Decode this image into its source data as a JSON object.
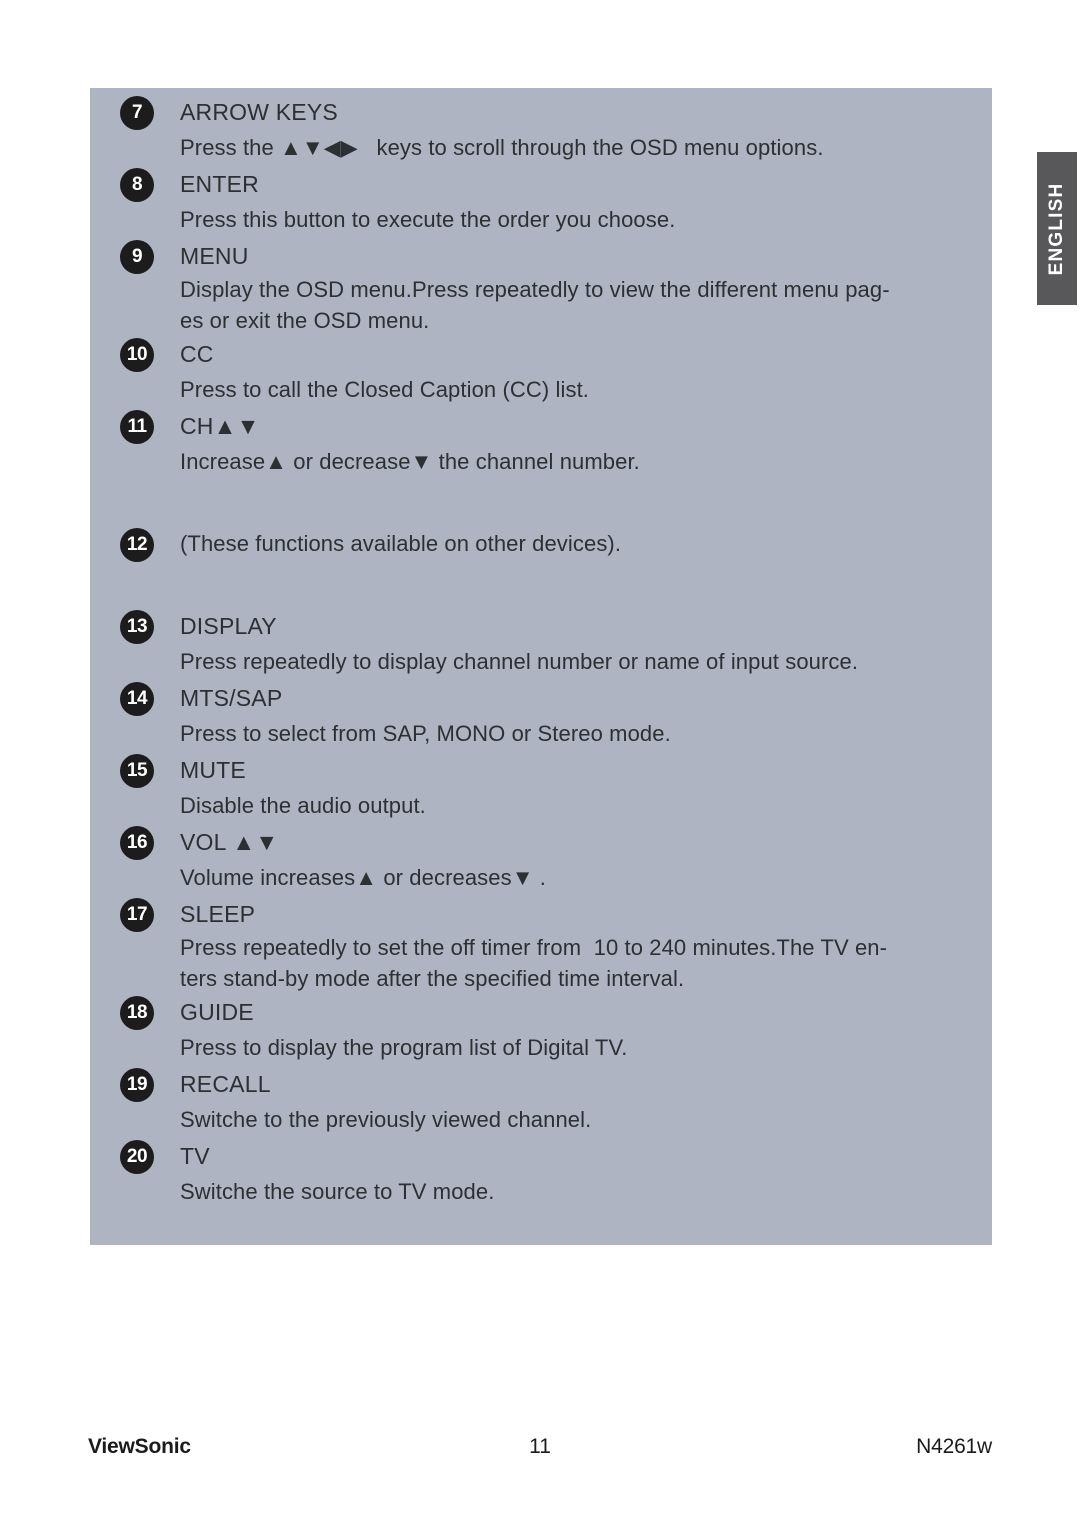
{
  "language_tab": {
    "label": "ENGLISH"
  },
  "panel": {
    "entries": [
      {
        "number": "7",
        "title": "ARROW KEYS",
        "desc": "Press the ▲▼◀▶   keys to scroll through the OSD menu options.",
        "gap_before": false
      },
      {
        "number": "8",
        "title": "ENTER",
        "desc": "Press this button to execute the order you choose.",
        "gap_before": false
      },
      {
        "number": "9",
        "title": "MENU",
        "desc": "Display the OSD menu.Press repeatedly to view the different menu pag-\nes or exit the OSD menu.",
        "gap_before": false
      },
      {
        "number": "10",
        "title": "CC",
        "desc": "Press to call the Closed Caption (CC) list.",
        "gap_before": false
      },
      {
        "number": "11",
        "title": "CH▲▼",
        "desc": "Increase▲ or decrease▼ the channel number.",
        "gap_before": false
      },
      {
        "number": "12",
        "title": "",
        "desc": "(These functions available on other devices).",
        "gap_before": true
      },
      {
        "number": "13",
        "title": "DISPLAY",
        "desc": "Press repeatedly to display channel number or name of input source.",
        "gap_before": true
      },
      {
        "number": "14",
        "title": "MTS/SAP",
        "desc": "Press to select from SAP, MONO or Stereo mode.",
        "gap_before": false
      },
      {
        "number": "15",
        "title": "MUTE",
        "desc": "Disable the audio output.",
        "gap_before": false
      },
      {
        "number": "16",
        "title": "VOL ▲▼",
        "desc": "Volume increases▲ or decreases▼ .",
        "gap_before": false
      },
      {
        "number": "17",
        "title": "SLEEP",
        "desc": "Press repeatedly to set the off timer from  10 to 240 minutes.The TV en-\nters stand-by mode after the specified time interval.",
        "gap_before": false
      },
      {
        "number": "18",
        "title": "GUIDE",
        "desc": "Press to display the program list of Digital TV.",
        "gap_before": false
      },
      {
        "number": "19",
        "title": "RECALL",
        "desc": "Switche to the previously viewed channel.",
        "gap_before": false
      },
      {
        "number": "20",
        "title": "TV",
        "desc": "Switche the source to TV mode.",
        "gap_before": false
      }
    ]
  },
  "footer": {
    "brand": "ViewSonic",
    "page_number": "11",
    "model": "N4261w"
  },
  "colors": {
    "panel_background": "#aeb4c2",
    "badge_background": "#1c1c1c",
    "badge_text": "#ffffff",
    "body_text": "#2b3133",
    "tab_background": "#58585a",
    "page_background": "#ffffff"
  }
}
